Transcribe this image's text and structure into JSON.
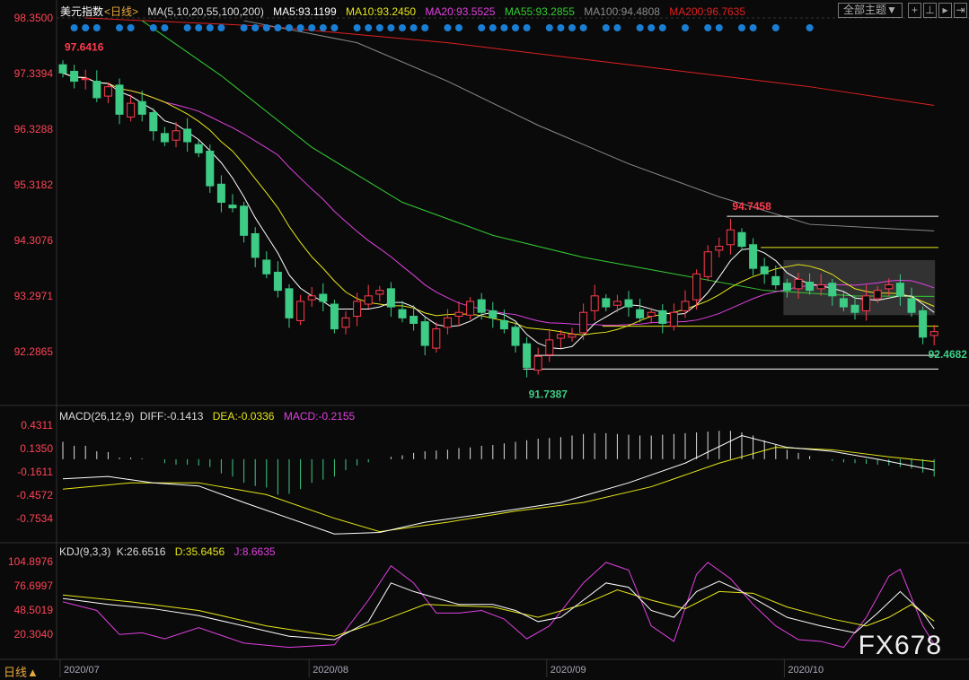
{
  "header": {
    "title": "美元指数",
    "period": "<日线>",
    "ma_label": "MA(5,10,20,55,100,200)",
    "ma5": "MA5:93.1199",
    "ma10": "MA10:93.2450",
    "ma20": "MA20:93.5525",
    "ma55": "MA55:93.2855",
    "ma100": "MA100:94.4808",
    "ma200": "MA200:96.7635",
    "theme_button": "全部主题▼"
  },
  "macd_header": {
    "label": "MACD(26,12,9)",
    "diff": "DIFF:-0.1413",
    "dea": "DEA:-0.0336",
    "macd": "MACD:-0.2155"
  },
  "kdj_header": {
    "label": "KDJ(9,3,3)",
    "k": "K:26.6516",
    "d": "D:35.6456",
    "j": "J:8.6635"
  },
  "footer": {
    "period": "日线▲",
    "logo": "FX678"
  },
  "colors": {
    "up": "#ff3b4e",
    "down": "#3dcb85",
    "ma5": "#ffffff",
    "ma10": "#e6e619",
    "ma20": "#e040e0",
    "ma55": "#33cc33",
    "ma100": "#8a8a8a",
    "ma200": "#e02020",
    "axis": "#ff4455"
  },
  "chart_data": [
    {
      "type": "candlestick",
      "title": "美元指数 日线",
      "yticks": [
        "98.3500",
        "97.3394",
        "96.3288",
        "95.3182",
        "94.3076",
        "93.2971",
        "92.2865"
      ],
      "ylim": [
        91.45,
        98.55
      ],
      "xticks": [
        {
          "i": 0,
          "label": "2020/07"
        },
        {
          "i": 22,
          "label": "2020/08"
        },
        {
          "i": 43,
          "label": "2020/09"
        },
        {
          "i": 64,
          "label": "2020/10"
        }
      ],
      "closes": [
        97.35,
        97.2,
        97.25,
        96.9,
        97.1,
        96.6,
        96.8,
        96.6,
        96.3,
        96.1,
        96.3,
        96.1,
        95.9,
        95.3,
        95.0,
        94.9,
        94.4,
        94.0,
        93.7,
        93.4,
        92.9,
        93.2,
        93.3,
        93.2,
        92.7,
        92.9,
        93.2,
        93.3,
        93.4,
        93.1,
        92.9,
        92.8,
        92.4,
        92.7,
        92.9,
        93.0,
        93.2,
        93.0,
        92.9,
        92.7,
        92.4,
        92.0,
        92.2,
        92.5,
        92.6,
        92.6,
        93.0,
        93.3,
        93.1,
        93.2,
        93.1,
        92.9,
        93.0,
        92.8,
        93.0,
        93.2,
        93.7,
        94.1,
        94.2,
        94.5,
        94.2,
        93.8,
        93.7,
        93.5,
        93.4,
        93.6,
        93.4,
        93.5,
        93.3,
        93.1,
        93.0,
        93.3,
        93.4,
        93.5,
        93.3,
        93.0,
        92.55,
        92.65
      ],
      "first_open": 97.5,
      "ma55": [
        [
          7,
          98.3
        ],
        [
          14,
          97.3
        ],
        [
          22,
          96.0
        ],
        [
          30,
          95.0
        ],
        [
          38,
          94.4
        ],
        [
          46,
          94.0
        ],
        [
          54,
          93.7
        ],
        [
          62,
          93.4
        ],
        [
          70,
          93.3
        ],
        [
          77,
          93.29
        ]
      ],
      "ma100": [
        [
          16,
          98.3
        ],
        [
          26,
          97.9
        ],
        [
          34,
          97.2
        ],
        [
          42,
          96.4
        ],
        [
          50,
          95.7
        ],
        [
          58,
          95.1
        ],
        [
          66,
          94.6
        ],
        [
          77,
          94.48
        ]
      ],
      "ma200": [
        [
          2,
          98.35
        ],
        [
          18,
          98.2
        ],
        [
          34,
          97.9
        ],
        [
          50,
          97.5
        ],
        [
          66,
          97.1
        ],
        [
          77,
          96.76
        ]
      ],
      "annotations": [
        {
          "label": "97.6416",
          "i": 0,
          "value": 97.6416
        },
        {
          "label": "94.7458",
          "i": 59,
          "value": 94.7458
        },
        {
          "label": "91.7387",
          "i": 41,
          "value": 91.7387
        },
        {
          "label": "92.4682",
          "i": 76,
          "value": 92.4682
        }
      ],
      "hlines": [
        {
          "value": 94.7458,
          "from": 59,
          "color": "#ffffff"
        },
        {
          "value": 94.18,
          "from": 62,
          "color": "#e6e619"
        },
        {
          "value": 92.75,
          "from": 48,
          "color": "#e6e619"
        },
        {
          "value": 92.22,
          "from": 42,
          "color": "#ffffff"
        },
        {
          "value": 91.97,
          "from": 41,
          "color": "#ffffff"
        }
      ],
      "range_box": {
        "from": 64,
        "to": 77,
        "high": 93.95,
        "low": 92.95
      },
      "signal_dots": [
        1,
        2,
        3,
        5,
        6,
        8,
        9,
        11,
        12,
        13,
        14,
        16,
        17,
        18,
        19,
        20,
        21,
        22,
        23,
        24,
        26,
        27,
        28,
        29,
        30,
        31,
        32,
        34,
        35,
        37,
        38,
        39,
        40,
        41,
        43,
        44,
        45,
        46,
        48,
        49,
        51,
        52,
        53,
        55,
        57,
        58,
        60,
        61,
        63,
        66
      ]
    },
    {
      "type": "macd",
      "yticks": [
        "0.4311",
        "0.1350",
        "-0.1611",
        "-0.4572",
        "-0.7534"
      ],
      "ylim": [
        -0.95,
        0.55
      ],
      "hist": [
        0.22,
        0.17,
        0.17,
        0.1,
        0.09,
        0.02,
        0.02,
        0.01,
        0.0,
        -0.05,
        -0.07,
        -0.07,
        -0.08,
        -0.1,
        -0.18,
        -0.22,
        -0.3,
        -0.34,
        -0.36,
        -0.45,
        -0.44,
        -0.38,
        -0.3,
        -0.26,
        -0.22,
        -0.14,
        -0.08,
        -0.04,
        0.0,
        0.03,
        0.05,
        0.08,
        0.1,
        0.11,
        0.12,
        0.14,
        0.15,
        0.17,
        0.18,
        0.2,
        0.22,
        0.24,
        0.26,
        0.27,
        0.28,
        0.3,
        0.32,
        0.33,
        0.33,
        0.32,
        0.31,
        0.3,
        0.3,
        0.31,
        0.32,
        0.33,
        0.34,
        0.35,
        0.36,
        0.36,
        0.34,
        0.3,
        0.24,
        0.18,
        0.12,
        0.08,
        0.04,
        0.0,
        -0.02,
        -0.04,
        -0.05,
        -0.06,
        -0.07,
        -0.08,
        -0.1,
        -0.12,
        -0.17,
        -0.22
      ],
      "diff": [
        [
          0,
          -0.25
        ],
        [
          4,
          -0.22
        ],
        [
          8,
          -0.3
        ],
        [
          12,
          -0.34
        ],
        [
          16,
          -0.55
        ],
        [
          20,
          -0.75
        ],
        [
          24,
          -0.95
        ],
        [
          28,
          -0.93
        ],
        [
          32,
          -0.8
        ],
        [
          38,
          -0.68
        ],
        [
          44,
          -0.55
        ],
        [
          50,
          -0.3
        ],
        [
          55,
          -0.05
        ],
        [
          60,
          0.3
        ],
        [
          64,
          0.15
        ],
        [
          68,
          0.1
        ],
        [
          72,
          0.0
        ],
        [
          77,
          -0.14
        ]
      ],
      "dea": [
        [
          0,
          -0.38
        ],
        [
          6,
          -0.3
        ],
        [
          12,
          -0.3
        ],
        [
          18,
          -0.45
        ],
        [
          24,
          -0.75
        ],
        [
          28,
          -0.92
        ],
        [
          34,
          -0.8
        ],
        [
          40,
          -0.66
        ],
        [
          46,
          -0.55
        ],
        [
          52,
          -0.35
        ],
        [
          58,
          -0.05
        ],
        [
          63,
          0.15
        ],
        [
          68,
          0.12
        ],
        [
          73,
          0.03
        ],
        [
          77,
          -0.03
        ]
      ]
    },
    {
      "type": "kdj",
      "yticks": [
        "104.8976",
        "76.6997",
        "48.5019",
        "20.3040"
      ],
      "ylim": [
        -5,
        112
      ],
      "k": [
        [
          0,
          62
        ],
        [
          4,
          55
        ],
        [
          8,
          50
        ],
        [
          12,
          42
        ],
        [
          16,
          30
        ],
        [
          20,
          18
        ],
        [
          24,
          14
        ],
        [
          27,
          35
        ],
        [
          29,
          80
        ],
        [
          31,
          70
        ],
        [
          35,
          55
        ],
        [
          38,
          55
        ],
        [
          40,
          48
        ],
        [
          42,
          35
        ],
        [
          44,
          40
        ],
        [
          46,
          60
        ],
        [
          48,
          80
        ],
        [
          50,
          75
        ],
        [
          52,
          48
        ],
        [
          54,
          40
        ],
        [
          56,
          70
        ],
        [
          58,
          82
        ],
        [
          60,
          70
        ],
        [
          62,
          55
        ],
        [
          64,
          40
        ],
        [
          67,
          30
        ],
        [
          70,
          22
        ],
        [
          72,
          45
        ],
        [
          74,
          70
        ],
        [
          76,
          45
        ],
        [
          77,
          26.65
        ]
      ],
      "d": [
        [
          0,
          66
        ],
        [
          6,
          58
        ],
        [
          12,
          48
        ],
        [
          18,
          30
        ],
        [
          24,
          18
        ],
        [
          28,
          35
        ],
        [
          32,
          55
        ],
        [
          38,
          52
        ],
        [
          42,
          40
        ],
        [
          46,
          55
        ],
        [
          49,
          72
        ],
        [
          52,
          60
        ],
        [
          55,
          50
        ],
        [
          58,
          70
        ],
        [
          61,
          68
        ],
        [
          64,
          52
        ],
        [
          68,
          38
        ],
        [
          71,
          30
        ],
        [
          73,
          40
        ],
        [
          75,
          55
        ],
        [
          77,
          35.65
        ]
      ],
      "j": [
        [
          0,
          58
        ],
        [
          3,
          48
        ],
        [
          5,
          20
        ],
        [
          7,
          22
        ],
        [
          9,
          15
        ],
        [
          12,
          28
        ],
        [
          16,
          10
        ],
        [
          20,
          5
        ],
        [
          24,
          8
        ],
        [
          27,
          60
        ],
        [
          29,
          100
        ],
        [
          31,
          80
        ],
        [
          33,
          45
        ],
        [
          35,
          45
        ],
        [
          37,
          48
        ],
        [
          39,
          38
        ],
        [
          41,
          15
        ],
        [
          43,
          30
        ],
        [
          46,
          80
        ],
        [
          48,
          104
        ],
        [
          50,
          95
        ],
        [
          52,
          30
        ],
        [
          54,
          12
        ],
        [
          56,
          90
        ],
        [
          57,
          104
        ],
        [
          59,
          85
        ],
        [
          61,
          55
        ],
        [
          63,
          30
        ],
        [
          65,
          14
        ],
        [
          67,
          12
        ],
        [
          69,
          5
        ],
        [
          71,
          40
        ],
        [
          73,
          88
        ],
        [
          74,
          96
        ],
        [
          76,
          30
        ],
        [
          77,
          8.66
        ]
      ]
    }
  ]
}
